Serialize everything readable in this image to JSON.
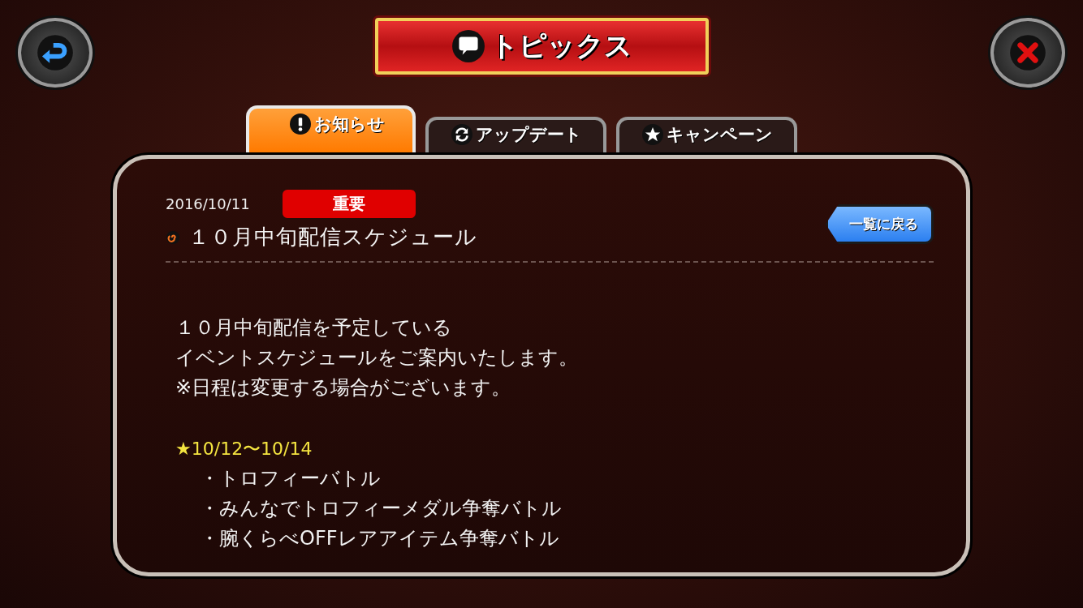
{
  "header": {
    "title": "トピックス"
  },
  "tabs": [
    {
      "label": "お知らせ",
      "kind": "notice",
      "selected": true
    },
    {
      "label": "アップデート",
      "kind": "update",
      "selected": false
    },
    {
      "label": "キャンペーン",
      "kind": "campaign",
      "selected": false
    }
  ],
  "article": {
    "date": "2016/10/11",
    "badge": "重要",
    "title": "１０月中旬配信スケジュール",
    "back_button": "一覧に戻る",
    "blocks": [
      {
        "kind": "text",
        "lines": [
          "１０月中旬配信を予定している",
          "イベントスケジュールをご案内いたします。",
          "※日程は変更する場合がございます。"
        ]
      },
      {
        "kind": "heading",
        "lines": [
          "★10/12〜10/14"
        ]
      },
      {
        "kind": "bullets",
        "lines": [
          "・トロフィーバトル",
          "・みんなでトロフィーメダル争奪バトル",
          "・腕くらべOFFレアアイテム争奪バトル"
        ]
      }
    ]
  }
}
